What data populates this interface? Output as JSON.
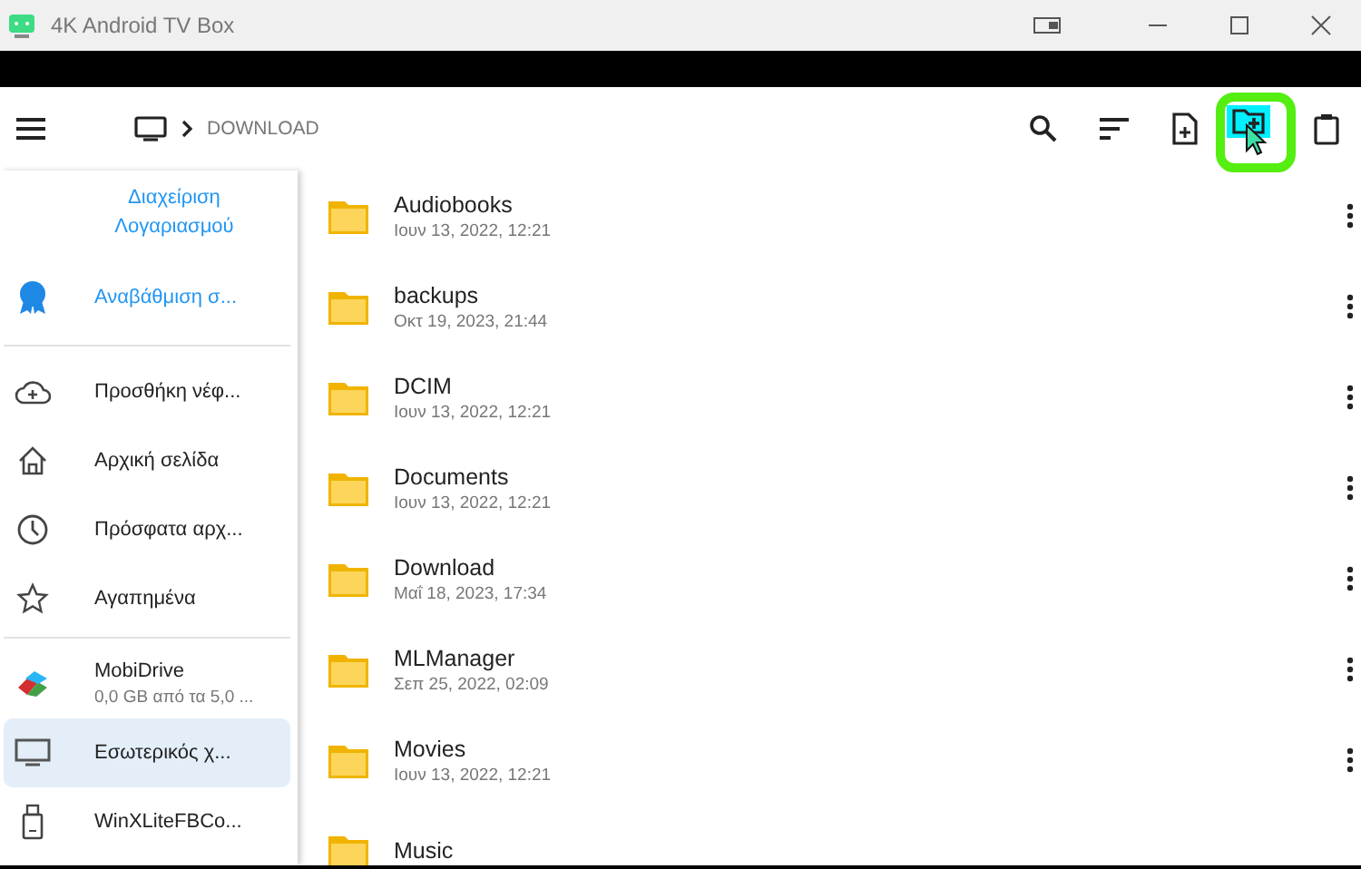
{
  "window": {
    "title": "4K Android TV Box"
  },
  "toolbar": {
    "breadcrumb": [
      {
        "kind": "device"
      },
      {
        "kind": "text",
        "label": "DOWNLOAD"
      }
    ],
    "actions": [
      {
        "kind": "search",
        "highlighted": false
      },
      {
        "kind": "sort",
        "highlighted": false
      },
      {
        "kind": "new-file",
        "highlighted": false
      },
      {
        "kind": "new-folder",
        "highlighted": true
      },
      {
        "kind": "paste",
        "highlighted": false
      }
    ]
  },
  "sidebar": {
    "account_link": "Διαχείριση Λογαριασμού",
    "sections": [
      [
        {
          "kind": "upgrade",
          "label": "Αναβάθμιση σ...",
          "selected": false
        }
      ],
      [
        {
          "kind": "cloud",
          "label": "Προσθήκη νέφ...",
          "selected": false
        },
        {
          "kind": "home",
          "label": "Αρχική σελίδα",
          "selected": false
        },
        {
          "kind": "recent",
          "label": "Πρόσφατα αρχ...",
          "selected": false
        },
        {
          "kind": "star",
          "label": "Αγαπημένα",
          "selected": false
        }
      ],
      [
        {
          "kind": "mobidrive",
          "label": "MobiDrive",
          "sub": "0,0 GB από τα 5,0 ...",
          "selected": false
        },
        {
          "kind": "device",
          "label": "Εσωτερικός χ...",
          "selected": true
        },
        {
          "kind": "usb",
          "label": "WinXLiteFBCo...",
          "selected": false
        }
      ]
    ]
  },
  "files": [
    {
      "name": "Audiobooks",
      "date": "Ιουν 13, 2022, 12:21"
    },
    {
      "name": "backups",
      "date": "Οκτ 19, 2023, 21:44"
    },
    {
      "name": "DCIM",
      "date": "Ιουν 13, 2022, 12:21"
    },
    {
      "name": "Documents",
      "date": "Ιουν 13, 2022, 12:21"
    },
    {
      "name": "Download",
      "date": "Μαΐ 18, 2023, 17:34"
    },
    {
      "name": "MLManager",
      "date": "Σεπ 25, 2022, 02:09"
    },
    {
      "name": "Movies",
      "date": "Ιουν 13, 2022, 12:21"
    },
    {
      "name": "Music"
    }
  ]
}
